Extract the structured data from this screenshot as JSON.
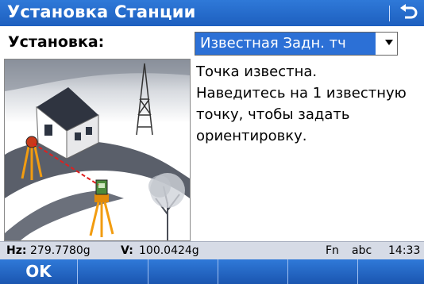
{
  "title_bar": {
    "title": "Установка Станции",
    "back_icon": "return-arrow-icon"
  },
  "setup": {
    "label": "Установка:",
    "selected_value": "Известная Задн. тч",
    "dropdown_icon": "chevron-down-icon"
  },
  "description": {
    "lines": [
      "Точка известна.",
      "Наведитесь на 1 известную",
      "точку, чтобы задать",
      "ориентировку."
    ]
  },
  "illustration": {
    "name": "station-setup-illustration"
  },
  "status_bar": {
    "hz_label": "Hz:",
    "hz_value": "279.7780g",
    "v_label": "V:",
    "v_value": "100.0424g",
    "fn": "Fn",
    "input_mode": "abc",
    "time": "14:33"
  },
  "softkeys": [
    "OK",
    "",
    "",
    "",
    "",
    ""
  ],
  "colors": {
    "title_blue": "#1d5fbf",
    "selection_blue": "#2c70d6",
    "status_gray": "#d6dbe6",
    "target_line": "#e02020"
  }
}
